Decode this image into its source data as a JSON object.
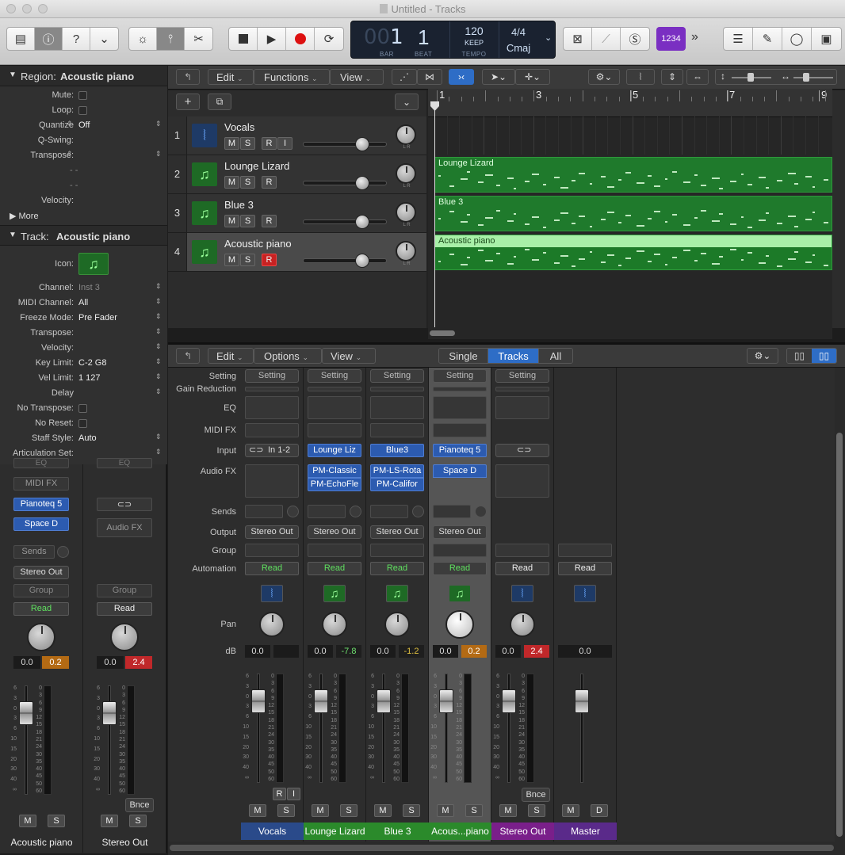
{
  "window": {
    "title": "Untitled - Tracks"
  },
  "toolbar": {
    "lcd": {
      "bar_dim": "00",
      "bar": "1",
      "beat": "1",
      "bar_lbl": "BAR",
      "beat_lbl": "BEAT",
      "tempo": "120",
      "keep": "KEEP",
      "tempo_lbl": "TEMPO",
      "sig": "4/4",
      "key": "Cmaj"
    },
    "count_in": "1234"
  },
  "inspector": {
    "region": {
      "header": "Region:",
      "name": "Acoustic piano",
      "rows": [
        {
          "label": "Mute:",
          "type": "check"
        },
        {
          "label": "Loop:",
          "type": "check"
        },
        {
          "label": "Quantize",
          "value": "Off",
          "type": "select"
        },
        {
          "label": "Q-Swing:",
          "type": "text"
        },
        {
          "label": "Transpose:",
          "type": "select"
        },
        {
          "label": "",
          "value": "- -",
          "type": "text"
        },
        {
          "label": "",
          "value": "- -",
          "type": "text"
        },
        {
          "label": "Velocity:",
          "type": "text"
        }
      ],
      "more": "More"
    },
    "track": {
      "header": "Track:",
      "name": "Acoustic piano",
      "icon_label": "Icon:",
      "rows": [
        {
          "label": "Channel:",
          "value": "Inst 3",
          "dim": true
        },
        {
          "label": "MIDI Channel:",
          "value": "All"
        },
        {
          "label": "Freeze Mode:",
          "value": "Pre Fader"
        },
        {
          "label": "Transpose:",
          "value": ""
        },
        {
          "label": "Velocity:",
          "value": ""
        },
        {
          "label": "Key Limit:",
          "value": "C-2  G8"
        },
        {
          "label": "Vel Limit:",
          "value": "1  127"
        },
        {
          "label": "Delay",
          "value": ""
        },
        {
          "label": "No Transpose:",
          "value": "",
          "check": true
        },
        {
          "label": "No Reset:",
          "value": "",
          "check": true
        },
        {
          "label": "Staff Style:",
          "value": "Auto"
        },
        {
          "label": "Articulation Set:",
          "value": ""
        }
      ]
    },
    "strips": [
      {
        "name": "Acoustic piano",
        "eq": "EQ",
        "midifx": "MIDI FX",
        "plugins": [
          "Pianoteq 5",
          "Space D"
        ],
        "sends": "Sends",
        "output": "Stereo Out",
        "group": "Group",
        "automation": "Read",
        "vol": "0.0",
        "peak": "0.2",
        "peak_color": "#b36a14",
        "m": "M",
        "s": "S"
      },
      {
        "name": "Stereo Out",
        "eq": "EQ",
        "audiofx": "Audio FX",
        "group": "Group",
        "automation": "Read",
        "vol": "0.0",
        "peak": "2.4",
        "peak_color": "#c0282a",
        "bnce": "Bnce",
        "m": "M",
        "s": "S"
      }
    ]
  },
  "tracks_menu": {
    "edit": "Edit",
    "functions": "Functions",
    "view": "View"
  },
  "ruler": {
    "marks": [
      "1",
      "3",
      "5",
      "7",
      "9"
    ]
  },
  "tracks": [
    {
      "num": "1",
      "name": "Vocals",
      "type": "audio",
      "btns": [
        "M",
        "S",
        "R",
        "I"
      ],
      "region": null
    },
    {
      "num": "2",
      "name": "Lounge Lizard",
      "type": "midi",
      "btns": [
        "M",
        "S",
        "R"
      ],
      "region": "Lounge Lizard"
    },
    {
      "num": "3",
      "name": "Blue 3",
      "type": "midi",
      "btns": [
        "M",
        "S",
        "R"
      ],
      "region": "Blue 3"
    },
    {
      "num": "4",
      "name": "Acoustic piano",
      "type": "midi",
      "btns": [
        "M",
        "S",
        "R"
      ],
      "region": "Acoustic piano",
      "selected": true
    }
  ],
  "knob_lr": "L  R",
  "mixer": {
    "menu": {
      "edit": "Edit",
      "options": "Options",
      "view": "View"
    },
    "filters": [
      "Single",
      "Tracks",
      "All"
    ],
    "row_labels": {
      "setting": "Setting",
      "gain": "Gain Reduction",
      "eq": "EQ",
      "midifx": "MIDI FX",
      "input": "Input",
      "audiofx": "Audio FX",
      "sends": "Sends",
      "output": "Output",
      "group": "Group",
      "automation": "Automation",
      "pan": "Pan",
      "db": "dB"
    },
    "strips": [
      {
        "name": "Vocals",
        "setting": "Setting",
        "input": "In 1-2",
        "input_link": true,
        "audiofx": [],
        "output": "Stereo Out",
        "automation": "Read",
        "auto_green": true,
        "icon": "waveform-icon",
        "vol": "0.0",
        "peak": "",
        "peak_color": "",
        "name_bg": "#2a4a8a",
        "ri": [
          "R",
          "I"
        ],
        "m": "M",
        "s": "S"
      },
      {
        "name": "Lounge Lizard",
        "setting": "Setting",
        "input": "Lounge Liz",
        "audiofx": [
          "PM-Classic",
          "PM-EchoFle"
        ],
        "output": "Stereo Out",
        "automation": "Read",
        "auto_green": true,
        "icon": "note-icon",
        "vol": "0.0",
        "peak": "-7.8",
        "peak_color": "#1e1e1e",
        "peak_fg": "#6ee06e",
        "name_bg": "#2b8a2b",
        "m": "M",
        "s": "S"
      },
      {
        "name": "Blue 3",
        "setting": "Setting",
        "input": "Blue3",
        "audiofx": [
          "PM-LS-Rota",
          "PM-Califor"
        ],
        "output": "Stereo Out",
        "automation": "Read",
        "auto_green": true,
        "icon": "note-icon",
        "vol": "0.0",
        "peak": "-1.2",
        "peak_color": "#1e1e1e",
        "peak_fg": "#e0c040",
        "name_bg": "#2b8a2b",
        "m": "M",
        "s": "S"
      },
      {
        "name": "Acous...piano",
        "setting": "Setting",
        "input": "Pianoteq 5",
        "audiofx": [
          "Space D"
        ],
        "output": "Stereo Out",
        "automation": "Read",
        "auto_green": true,
        "icon": "note-icon",
        "vol": "0.0",
        "peak": "0.2",
        "peak_color": "#b36a14",
        "name_bg": "#2b8a2b",
        "selected": true,
        "m": "M",
        "s": "S"
      },
      {
        "name": "Stereo Out",
        "setting": "Setting",
        "input": "",
        "input_link": true,
        "audiofx": [],
        "output": "",
        "automation": "Read",
        "auto_green": false,
        "icon": "waveform-icon",
        "vol": "0.0",
        "peak": "2.4",
        "peak_color": "#c0282a",
        "name_bg": "#7a1f8a",
        "bnce": "Bnce",
        "m": "M",
        "s": "S"
      },
      {
        "name": "Master",
        "automation": "Read",
        "auto_green": false,
        "icon": "waveform-icon",
        "vol": "0.0",
        "name_bg": "#5a2a8a",
        "m": "M",
        "s": "D",
        "master": true
      }
    ]
  },
  "fader_scale": [
    "6",
    "3",
    "0",
    "3",
    "6",
    "10",
    "15",
    "20",
    "30",
    "40",
    "∞"
  ],
  "meter_scale": [
    "0",
    "3",
    "6",
    "9",
    "12",
    "15",
    "18",
    "21",
    "24",
    "30",
    "35",
    "40",
    "45",
    "50",
    "60"
  ]
}
